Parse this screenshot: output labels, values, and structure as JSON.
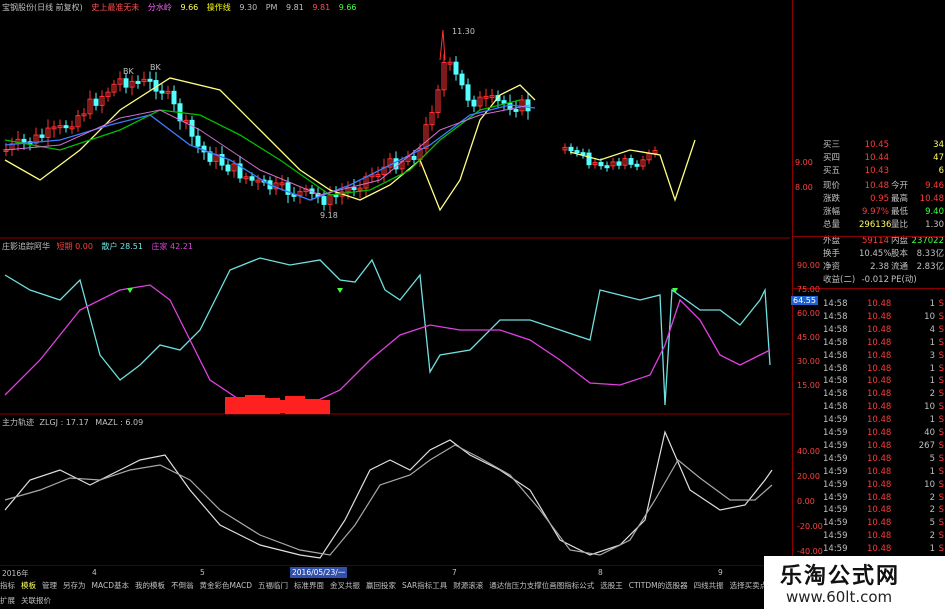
{
  "title": {
    "stock": "宝钢股份(日线 前复权)",
    "signal": "史上最准无未",
    "score_label": "分水岭",
    "score_value": "9.66",
    "op_label": "操作线",
    "op_time": "9.30",
    "pm_label": "PM",
    "pm_value": "9.81",
    "v1": "9.81",
    "v2": "9.66"
  },
  "main_chart": {
    "high_label": "11.30",
    "low_label": "9.18",
    "marker_b": "B",
    "marker_k": "K"
  },
  "indicator1": {
    "title": "庄影追踪阿华",
    "series1_label": "散户",
    "series1_value": "28.51",
    "series2_label": "庄家",
    "series2_value": "42.21",
    "lead_label": "短期",
    "lead_value": "0.00",
    "axis": [
      "90.00",
      "75.00",
      "60.00",
      "45.00",
      "30.00",
      "15.00"
    ],
    "current_tag": "64.55"
  },
  "indicator2": {
    "title": "主力轨迹",
    "zl_label": "ZLGJ",
    "zl_value": "17.17",
    "mazl_label": "MAZL",
    "mazl_value": "6.09",
    "axis": [
      "40.00",
      "20.00",
      "0.00",
      "-20.00",
      "-40.00"
    ]
  },
  "date_axis": {
    "start": "2016年",
    "m4": "4",
    "m5": "5",
    "cursor_date": "2016/05/23/一",
    "m7": "7",
    "m8": "8",
    "m9": "9"
  },
  "quotes": {
    "levels": [
      {
        "label": "买三",
        "price": "10.45",
        "vol": "34"
      },
      {
        "label": "买四",
        "price": "10.44",
        "vol": "47"
      },
      {
        "label": "买五",
        "price": "10.43",
        "vol": "6"
      }
    ],
    "price_axis": [
      "9.00",
      "8.00"
    ],
    "rows": [
      {
        "l1": "现价",
        "v1": "10.48",
        "l2": "今开",
        "v2": "9.46"
      },
      {
        "l1": "涨跌",
        "v1": "0.95",
        "l2": "最高",
        "v2": "10.48"
      },
      {
        "l1": "涨幅",
        "v1": "9.97%",
        "l2": "最低",
        "v2": "9.40"
      },
      {
        "l1": "总量",
        "v1": "296136",
        "l2": "量比",
        "v2": "1.30"
      },
      {
        "l1": "外盘",
        "v1": "59114",
        "l2": "内盘",
        "v2": "237022"
      },
      {
        "l1": "换手",
        "v1": "10.45%",
        "l2": "股本",
        "v2": "8.33亿"
      },
      {
        "l1": "净资",
        "v1": "2.38",
        "l2": "流通",
        "v2": "2.83亿"
      },
      {
        "l1": "收益(二)",
        "v1": "-0.012",
        "l2": "PE(动)",
        "v2": ""
      }
    ]
  },
  "ticks": [
    {
      "t": "14:58",
      "p": "10.48",
      "v": "1",
      "d": "S"
    },
    {
      "t": "14:58",
      "p": "10.48",
      "v": "10",
      "d": "S"
    },
    {
      "t": "14:58",
      "p": "10.48",
      "v": "4",
      "d": "S"
    },
    {
      "t": "14:58",
      "p": "10.48",
      "v": "1",
      "d": "S"
    },
    {
      "t": "14:58",
      "p": "10.48",
      "v": "3",
      "d": "S"
    },
    {
      "t": "14:58",
      "p": "10.48",
      "v": "1",
      "d": "S"
    },
    {
      "t": "14:58",
      "p": "10.48",
      "v": "1",
      "d": "S"
    },
    {
      "t": "14:58",
      "p": "10.48",
      "v": "2",
      "d": "S"
    },
    {
      "t": "14:58",
      "p": "10.48",
      "v": "10",
      "d": "S"
    },
    {
      "t": "14:59",
      "p": "10.48",
      "v": "1",
      "d": "S"
    },
    {
      "t": "14:59",
      "p": "10.48",
      "v": "40",
      "d": "S"
    },
    {
      "t": "14:59",
      "p": "10.48",
      "v": "267",
      "d": "S"
    },
    {
      "t": "14:59",
      "p": "10.48",
      "v": "5",
      "d": "S"
    },
    {
      "t": "14:59",
      "p": "10.48",
      "v": "1",
      "d": "S"
    },
    {
      "t": "14:59",
      "p": "10.48",
      "v": "10",
      "d": "S"
    },
    {
      "t": "14:59",
      "p": "10.48",
      "v": "2",
      "d": "S"
    },
    {
      "t": "14:59",
      "p": "10.48",
      "v": "2",
      "d": "S"
    },
    {
      "t": "14:59",
      "p": "10.48",
      "v": "5",
      "d": "S"
    },
    {
      "t": "14:59",
      "p": "10.48",
      "v": "2",
      "d": "S"
    },
    {
      "t": "14:59",
      "p": "10.48",
      "v": "1",
      "d": "S"
    },
    {
      "t": "14:59",
      "p": "10.48",
      "v": "6",
      "d": "S"
    }
  ],
  "tabs": [
    "指标",
    "模板",
    "管理",
    "另存为",
    "MACD基本",
    "我的模板",
    "不倒翁",
    "黄金彩色MACD",
    "五福临门",
    "标准界面",
    "金叉共振",
    "赢回投家",
    "SAR指标工具",
    "财源滚滚",
    "通达信压力支撑位画图指标公式",
    "选股王",
    "CTITDM的选股器",
    "四线共振",
    "选择买卖点线法",
    "止损线",
    "高价"
  ],
  "tabs_row2": [
    "扩展",
    "关联报价"
  ],
  "watermark": {
    "name": "乐淘公式网",
    "url": "www.60lt.com"
  },
  "colors": {
    "up": "#ff3232",
    "down": "#54ffff",
    "ma_yellow": "#ffff80",
    "ma_white": "#ffffff",
    "ma_green": "#00c000",
    "ma_blue": "#3c7cff",
    "magenta": "#e040e0",
    "cyan": "#70e0e0"
  }
}
